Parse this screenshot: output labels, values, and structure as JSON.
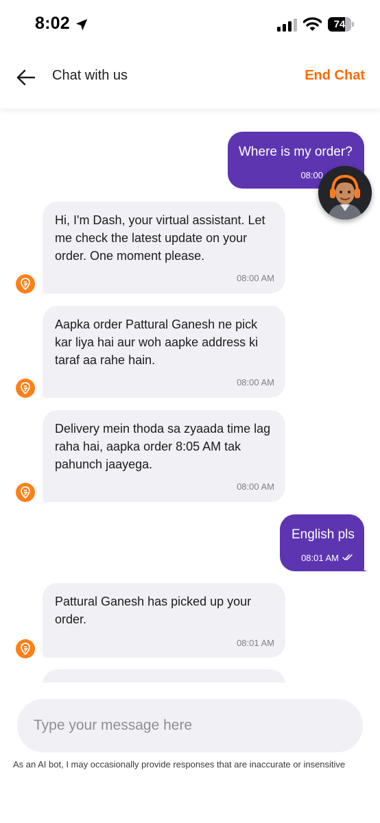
{
  "status_bar": {
    "time": "8:02",
    "battery": "74",
    "battery_level": 0.74
  },
  "header": {
    "title": "Chat with us",
    "end_chat_label": "End Chat"
  },
  "messages": [
    {
      "sender": "user",
      "text": "Where is my order?",
      "time": "08:00"
    },
    {
      "sender": "bot",
      "text": "Hi, I'm Dash, your virtual assistant. Let me check the latest update on your order. One moment please.",
      "time": "08:00 AM"
    },
    {
      "sender": "bot",
      "text": "Aapka order Pattural Ganesh ne pick kar liya hai aur woh aapke address ki taraf aa rahe hain.",
      "time": "08:00 AM"
    },
    {
      "sender": "bot",
      "text": "Delivery mein thoda sa zyaada time lag raha hai, aapka order 8:05 AM tak pahunch jaayega.",
      "time": "08:00 AM"
    },
    {
      "sender": "user",
      "text": "English pls",
      "time": "08:01 AM"
    },
    {
      "sender": "bot",
      "text": "Pattural Ganesh has picked up your order.",
      "time": "08:01 AM"
    }
  ],
  "input": {
    "placeholder": "Type your message here"
  },
  "disclaimer": "As an AI bot, I may occasionally provide responses that are inaccurate or insensitive",
  "icons": {
    "back": "back-arrow-icon",
    "location": "location-arrow-icon",
    "signal": "cellular-signal-icon",
    "wifi": "wifi-icon",
    "bot": "swiggy-logo-icon",
    "read_receipt": "double-check-icon"
  },
  "colors": {
    "accent": "#fc6a04",
    "user_bubble": "#5e35b1",
    "bot_bubble": "#f1f1f5",
    "bot_avatar": "#fc8019"
  }
}
